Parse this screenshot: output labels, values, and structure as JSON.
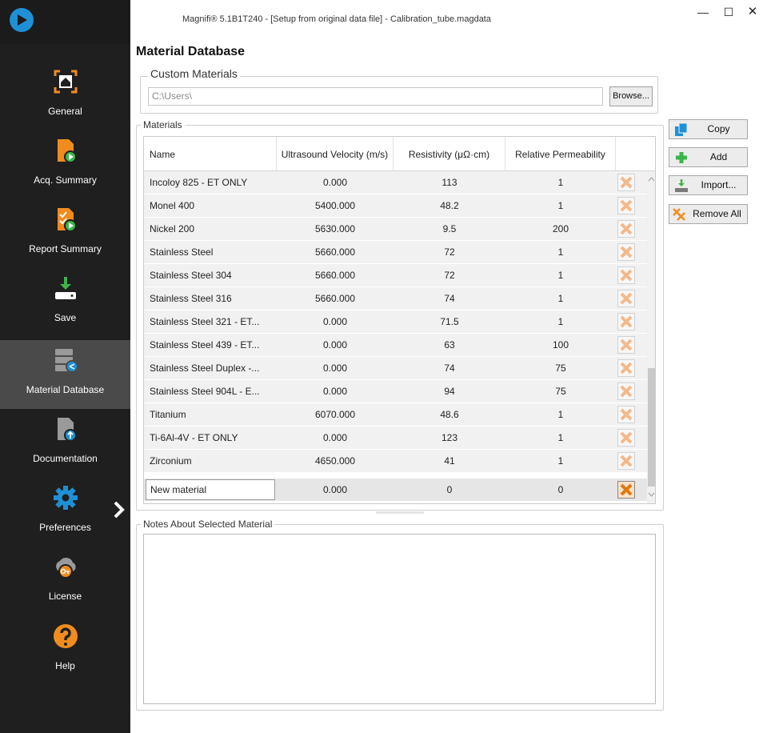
{
  "window": {
    "title": "Magnifi® 5.1B1T240 - [Setup from original data file] - Calibration_tube.magdata",
    "minimize": "—",
    "maximize": "☐",
    "close": "✕"
  },
  "sidebar": {
    "items": [
      {
        "label": "General",
        "icon": "home-icon"
      },
      {
        "label": "Acq. Summary",
        "icon": "acq-summary-icon"
      },
      {
        "label": "Report Summary",
        "icon": "report-summary-icon"
      },
      {
        "label": "Save",
        "icon": "save-icon"
      },
      {
        "label": "Material Database",
        "icon": "material-database-icon",
        "active": true
      },
      {
        "label": "Documentation",
        "icon": "documentation-icon"
      },
      {
        "label": "Preferences",
        "icon": "gear-icon"
      },
      {
        "label": "License",
        "icon": "license-icon"
      },
      {
        "label": "Help",
        "icon": "help-icon"
      }
    ]
  },
  "page": {
    "heading": "Material Database"
  },
  "custom_materials": {
    "label": "Custom Materials",
    "path": "C:\\Users\\",
    "browse_label": "Browse..."
  },
  "materials": {
    "label": "Materials",
    "columns": {
      "name": "Name",
      "velocity": "Ultrasound Velocity (m/s)",
      "resistivity": "Resistivity (μΩ·cm)",
      "permeability": "Relative Permeability"
    },
    "rows": [
      {
        "name": "Incoloy 825 - ET ONLY",
        "velocity": "0.000",
        "resistivity": "113",
        "permeability": "1"
      },
      {
        "name": "Monel 400",
        "velocity": "5400.000",
        "resistivity": "48.2",
        "permeability": "1"
      },
      {
        "name": "Nickel 200",
        "velocity": "5630.000",
        "resistivity": "9.5",
        "permeability": "200"
      },
      {
        "name": "Stainless Steel",
        "velocity": "5660.000",
        "resistivity": "72",
        "permeability": "1"
      },
      {
        "name": "Stainless Steel 304",
        "velocity": "5660.000",
        "resistivity": "72",
        "permeability": "1"
      },
      {
        "name": "Stainless Steel 316",
        "velocity": "5660.000",
        "resistivity": "74",
        "permeability": "1"
      },
      {
        "name": "Stainless Steel 321 - ET...",
        "velocity": "0.000",
        "resistivity": "71.5",
        "permeability": "1"
      },
      {
        "name": "Stainless Steel 439 - ET...",
        "velocity": "0.000",
        "resistivity": "63",
        "permeability": "100"
      },
      {
        "name": "Stainless Steel Duplex -...",
        "velocity": "0.000",
        "resistivity": "74",
        "permeability": "75"
      },
      {
        "name": "Stainless Steel 904L - E...",
        "velocity": "0.000",
        "resistivity": "94",
        "permeability": "75"
      },
      {
        "name": "Titanium",
        "velocity": "6070.000",
        "resistivity": "48.6",
        "permeability": "1"
      },
      {
        "name": "Ti-6Al-4V - ET ONLY",
        "velocity": "0.000",
        "resistivity": "123",
        "permeability": "1"
      },
      {
        "name": "Zirconium",
        "velocity": "4650.000",
        "resistivity": "41",
        "permeability": "1"
      }
    ],
    "new_row": {
      "name": "New material",
      "velocity": "0.000",
      "resistivity": "0",
      "permeability": "0"
    }
  },
  "actions": {
    "copy": "Copy",
    "add": "Add",
    "import": "Import...",
    "remove_all": "Remove All"
  },
  "notes": {
    "label": "Notes About Selected Material",
    "value": ""
  },
  "colors": {
    "sidebar_bg": "#1f1f1f",
    "accent_orange": "#f08c1e",
    "accent_blue": "#1e90d6",
    "add_green": "#3cb44a"
  }
}
